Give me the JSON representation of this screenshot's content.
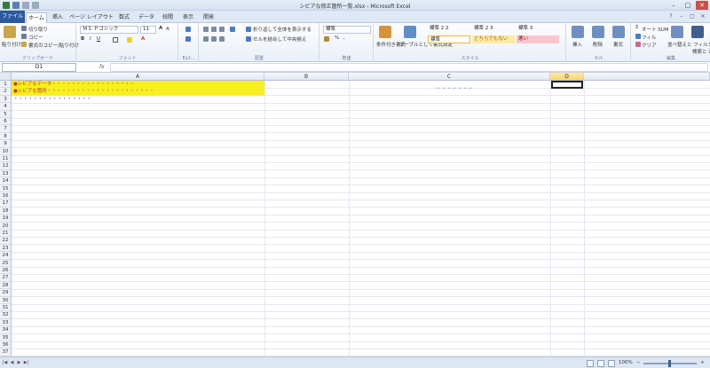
{
  "window": {
    "title": "シビアな修正箇所一覧.xlsx - Microsoft Excel"
  },
  "tabs": [
    {
      "label": "ファイル"
    },
    {
      "label": "ホーム"
    },
    {
      "label": "挿入"
    },
    {
      "label": "ページ レイアウト"
    },
    {
      "label": "数式"
    },
    {
      "label": "データ"
    },
    {
      "label": "校閲"
    },
    {
      "label": "表示"
    },
    {
      "label": "開発"
    }
  ],
  "ribbon": {
    "clipboard": {
      "paste": "貼り付け",
      "cut": "切り取り",
      "copy": "コピー",
      "format_painter": "書式のコピー/貼り付け",
      "label": "クリップボード"
    },
    "font": {
      "name": "ＭＳ Ｐゴシック",
      "size": "11",
      "label": "フォント"
    },
    "alignment": {
      "wrap": "折り返して全体を表示する",
      "merge": "セルを結合して中央揃え",
      "label": "配置",
      "ex_label": "Ex2..."
    },
    "number": {
      "format": "標準",
      "label": "数値"
    },
    "styles": {
      "cond": "条件付き書式",
      "table": "テーブルとして書式設定",
      "style22": "標準 2 2",
      "style23": "標準 2 3",
      "style3": "標準 3",
      "normal": "標準",
      "neutral": "どちらでもない",
      "bad": "悪い",
      "label": "スタイル"
    },
    "cells": {
      "insert": "挿入",
      "delete": "削除",
      "format": "書式",
      "label": "セル"
    },
    "editing": {
      "autosum": "オート SUM",
      "fill": "フィル",
      "clear": "クリア",
      "sort": "並べ替えと フィルター",
      "find": "検索と 選択",
      "label": "編集"
    }
  },
  "formula_bar": {
    "name_box": "D1",
    "fx": "fx",
    "value": ""
  },
  "grid": {
    "columns": [
      "A",
      "B",
      "C",
      "D"
    ],
    "selected_column": "D",
    "rows": [
      "1",
      "2",
      "3",
      "4",
      "5",
      "6",
      "7",
      "8",
      "9",
      "10",
      "11",
      "12",
      "13",
      "14",
      "15",
      "16",
      "17",
      "18",
      "19",
      "20",
      "21",
      "22",
      "23",
      "24",
      "25",
      "26",
      "27",
      "28",
      "29",
      "30",
      "31",
      "32",
      "33",
      "34",
      "35",
      "36",
      "37"
    ],
    "row1_text": "●シビアなデータ・・・・・・・・・・・・・・・・・",
    "row2_text": "●シビアな箇所・・・・・・・・・・・・・・・・・・・・・・",
    "row3_text": "・・・・・・・・・・・・・・・・",
    "c2_text": "・・・・・・・"
  },
  "status": {
    "zoom": "100%"
  }
}
